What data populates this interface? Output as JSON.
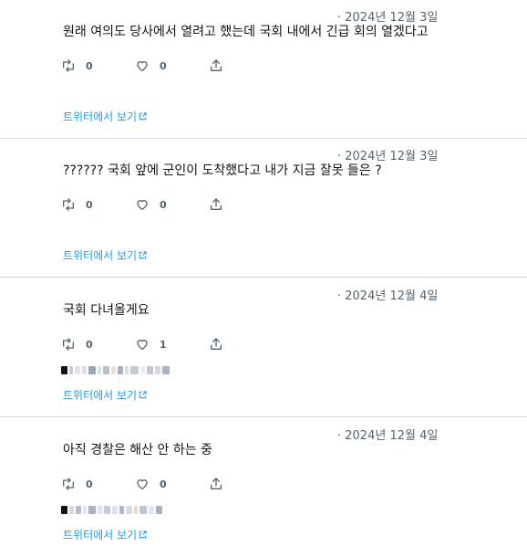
{
  "tweets": [
    {
      "date": "· 2024년 12월 3일",
      "text": "원래 여의도 당사에서 열려고 했는데 국회 내에서 긴급 회의 열겠다고",
      "retweets": "0",
      "likes": "0",
      "link_label": "트위터에서 보기"
    },
    {
      "date": "· 2024년 12월 3일",
      "text": "?????? 국회 앞에 군인이 도착했다고 내가 지금 잘못 들은 ?",
      "retweets": "0",
      "likes": "0",
      "link_label": "트위터에서 보기"
    },
    {
      "date": "· 2024년 12월 4일",
      "text": "국회 다녀올게요",
      "retweets": "0",
      "likes": "1",
      "link_label": "트위터에서 보기"
    },
    {
      "date": "· 2024년 12월 4일",
      "text": "아직 경찰은 해산 안 하는 중",
      "retweets": "0",
      "likes": "0",
      "link_label": "트위터에서 보기"
    }
  ],
  "icons": {
    "retweet": "retweet-icon",
    "like": "heart-icon",
    "share": "share-icon",
    "external": "external-link-icon"
  },
  "colors": {
    "text": "#0f1419",
    "muted": "#536471",
    "link": "#1d9bf0",
    "divider": "#cfd9de"
  }
}
